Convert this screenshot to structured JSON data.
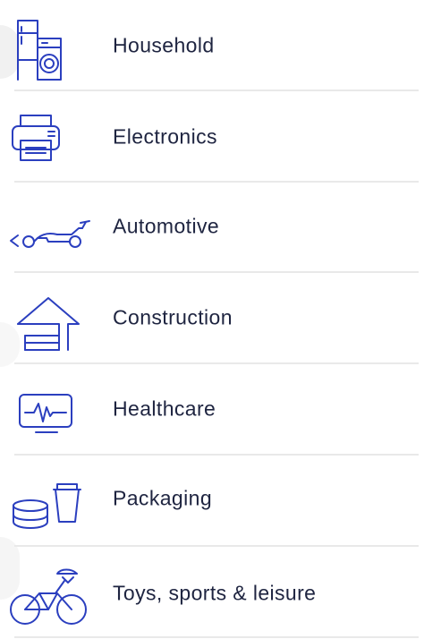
{
  "theme": {
    "icon_color": "#2b3fbf",
    "text_color": "#1e2440",
    "divider_color": "#e9e9e9"
  },
  "categories": [
    {
      "label": "Household",
      "icon": "household-appliances-icon"
    },
    {
      "label": "Electronics",
      "icon": "printer-icon"
    },
    {
      "label": "Automotive",
      "icon": "race-car-icon"
    },
    {
      "label": "Construction",
      "icon": "house-icon"
    },
    {
      "label": "Healthcare",
      "icon": "heart-monitor-icon"
    },
    {
      "label": "Packaging",
      "icon": "container-cup-icon"
    },
    {
      "label": "Toys, sports & leisure",
      "icon": "bicycle-icon"
    }
  ]
}
